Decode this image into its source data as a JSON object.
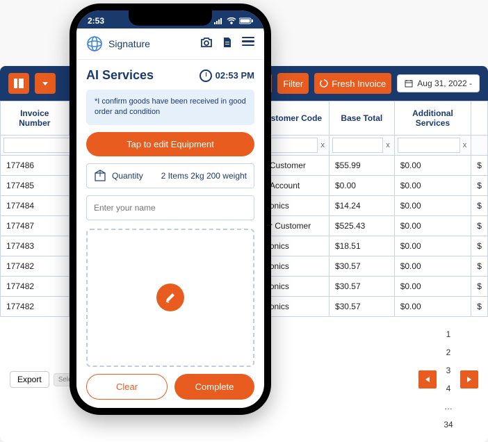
{
  "table": {
    "toolbar": {
      "filter_label": "Filter",
      "fresh_invoice_label": "Fresh Invoice",
      "date": "Aug 31, 2022 -"
    },
    "columns": [
      "Invoice Number",
      "Customer Code",
      "Base Total",
      "Additional Services"
    ],
    "column_fragments": [
      "Invoice Number",
      "stomer Code",
      "Base Total",
      "Additional Services"
    ],
    "rows": [
      {
        "invoice": "177486",
        "customer": " Customer",
        "base": "$55.99",
        "addl": "$0.00",
        "extra": "$"
      },
      {
        "invoice": "177485",
        "customer": "Account",
        "base": "$0.00",
        "addl": "$0.00",
        "extra": "$"
      },
      {
        "invoice": "177484",
        "customer": "onics",
        "base": "$14.24",
        "addl": "$0.00",
        "extra": "$"
      },
      {
        "invoice": "177487",
        "customer": "r Customer",
        "base": "$525.43",
        "addl": "$0.00",
        "extra": "$"
      },
      {
        "invoice": "177483",
        "customer": "onics",
        "base": "$18.51",
        "addl": "$0.00",
        "extra": "$"
      },
      {
        "invoice": "177482",
        "customer": "onics",
        "base": "$30.57",
        "addl": "$0.00",
        "extra": "$"
      },
      {
        "invoice": "177482",
        "customer": "onics",
        "base": "$30.57",
        "addl": "$0.00",
        "extra": "$"
      },
      {
        "invoice": "177482",
        "customer": "onics",
        "base": "$30.57",
        "addl": "$0.00",
        "extra": "$"
      }
    ],
    "export_label": "Export",
    "export_placeholder": "Select type",
    "pages": [
      "1",
      "2",
      "3",
      "4",
      "…",
      "34"
    ]
  },
  "phone": {
    "status_time": "2:53",
    "app_title": "Signature",
    "service_title": "AI Services",
    "clock_time": "02:53 PM",
    "confirm_text": "*I confirm goods have been received in good order and condition",
    "equipment_btn": "Tap to edit Equipment",
    "qty_label": "Quantity",
    "qty_value": "2 Items 2kg 200 weight",
    "name_placeholder": "Enter your name",
    "clear_btn": "Clear",
    "complete_btn": "Complete"
  }
}
